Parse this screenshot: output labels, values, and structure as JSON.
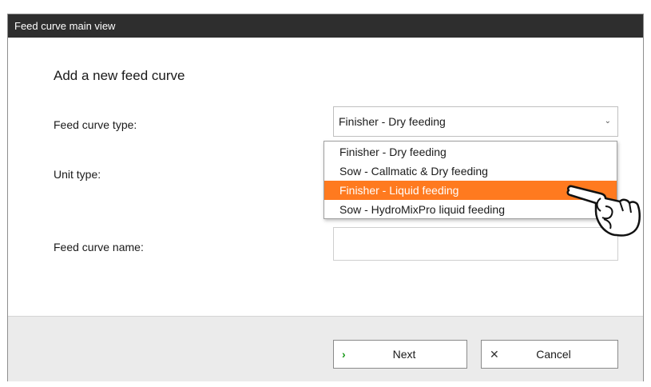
{
  "window": {
    "title": "Feed curve main view"
  },
  "form": {
    "heading": "Add a new feed curve",
    "feed_curve_type_label": "Feed curve type:",
    "unit_type_label": "Unit type:",
    "feed_curve_name_label": "Feed curve name:",
    "feed_curve_type_value": "Finisher - Dry feeding",
    "feed_curve_name_value": ""
  },
  "dropdown": {
    "options": [
      {
        "label": "Finisher - Dry feeding",
        "highlighted": false
      },
      {
        "label": "Sow - Callmatic & Dry feeding",
        "highlighted": false
      },
      {
        "label": "Finisher - Liquid feeding",
        "highlighted": true
      },
      {
        "label": "Sow - HydroMixPro liquid feeding",
        "highlighted": false
      }
    ]
  },
  "footer": {
    "next_label": "Next",
    "cancel_label": "Cancel",
    "next_icon": "chevron-right-icon",
    "cancel_icon": "close-icon"
  },
  "colors": {
    "titlebar": "#2e2e2e",
    "highlight": "#ff7a1f",
    "next_icon": "#1a9a1a"
  },
  "icons": {
    "pointer": "hand-pointer-icon",
    "select": "chevron-down-icon"
  }
}
